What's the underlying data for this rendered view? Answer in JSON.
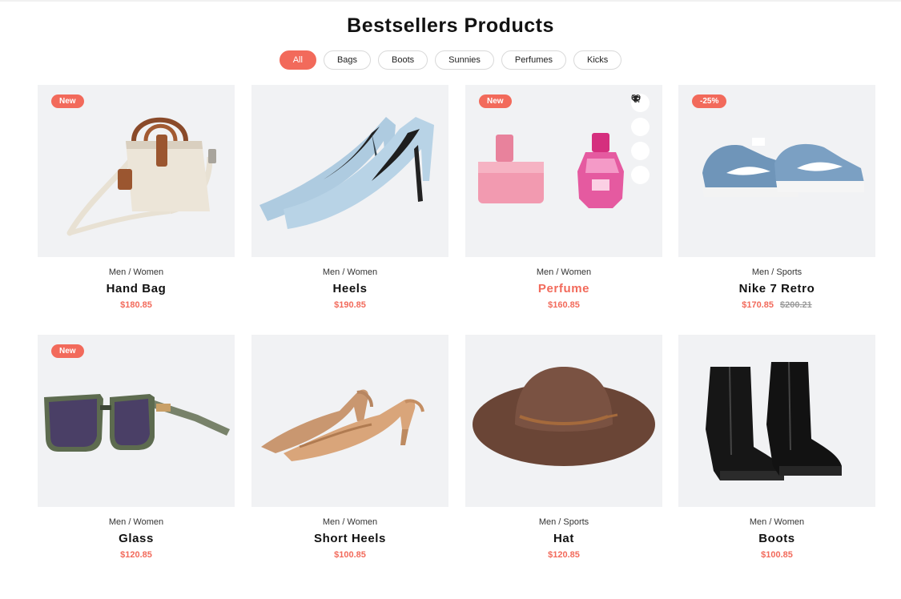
{
  "title": "Bestsellers Products",
  "filters": [
    "All",
    "Bags",
    "Boots",
    "Sunnies",
    "Perfumes",
    "Kicks"
  ],
  "active_filter": "All",
  "colors": {
    "accent": "#f26a5b",
    "card_bg": "#f1f2f4",
    "old_price": "#9a9a9a"
  },
  "products": [
    {
      "badge": "New",
      "category": "Men / Women",
      "name": "Hand Bag",
      "price": "$180.85",
      "old_price": ""
    },
    {
      "badge": "",
      "category": "Men / Women",
      "name": "Heels",
      "price": "$190.85",
      "old_price": ""
    },
    {
      "badge": "New",
      "category": "Men / Women",
      "name": "Perfume",
      "price": "$160.85",
      "old_price": "",
      "hovered": true,
      "actions": [
        "cart-icon",
        "heart-icon",
        "eye-icon",
        "compare-icon"
      ]
    },
    {
      "badge": "-25%",
      "category": "Men / Sports",
      "name": "Nike 7 Retro",
      "price": "$170.85",
      "old_price": "$200.21"
    },
    {
      "badge": "New",
      "category": "Men / Women",
      "name": "Glass",
      "price": "$120.85",
      "old_price": ""
    },
    {
      "badge": "",
      "category": "Men / Women",
      "name": "Short Heels",
      "price": "$100.85",
      "old_price": ""
    },
    {
      "badge": "",
      "category": "Men / Sports",
      "name": "Hat",
      "price": "$120.85",
      "old_price": ""
    },
    {
      "badge": "",
      "category": "Men / Women",
      "name": "Boots",
      "price": "$100.85",
      "old_price": ""
    }
  ]
}
